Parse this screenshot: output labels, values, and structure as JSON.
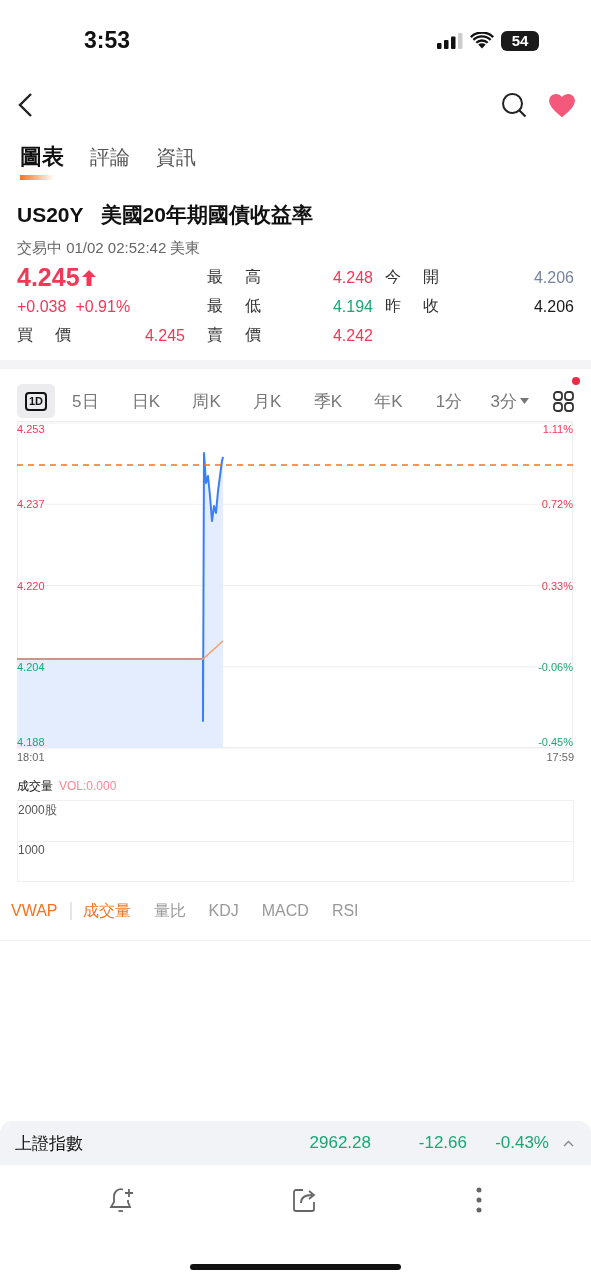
{
  "status_bar": {
    "time": "3:53",
    "battery": "54"
  },
  "nav": {
    "favorite": true
  },
  "tabs": [
    {
      "label": "圖表",
      "selected": true
    },
    {
      "label": "評論",
      "selected": false
    },
    {
      "label": "資訊",
      "selected": false
    }
  ],
  "instrument": {
    "symbol": "US20Y",
    "name": "美國20年期國債收益率",
    "status": "交易中 01/02 02:52:42 美東"
  },
  "quote": {
    "price": "4.245",
    "rising": true,
    "color": "#ee3a57",
    "change": "+0.038",
    "change_pct": "+0.91%",
    "bid": {
      "label": "買 價",
      "value": "4.245",
      "color": "#ee3a57"
    },
    "stats": [
      {
        "label": "最 高",
        "value": "4.248",
        "color": "#ee3a57"
      },
      {
        "label": "今 開",
        "value": "4.206",
        "color": "#7683a0"
      },
      {
        "label": "最 低",
        "value": "4.194",
        "color": "#17a974"
      },
      {
        "label": "昨 收",
        "value": "4.206",
        "color": "#1a1a1a"
      },
      {
        "label": "賣 價",
        "value": "4.242",
        "color": "#ee3a57"
      }
    ]
  },
  "periods": {
    "items": [
      {
        "label": "1D",
        "kind": "icon",
        "selected": true
      },
      {
        "label": "5日",
        "kind": "text",
        "selected": false
      },
      {
        "label": "日K",
        "kind": "text",
        "selected": false
      },
      {
        "label": "周K",
        "kind": "text",
        "selected": false
      },
      {
        "label": "月K",
        "kind": "text",
        "selected": false
      },
      {
        "label": "季K",
        "kind": "text",
        "selected": false
      },
      {
        "label": "年K",
        "kind": "text",
        "selected": false
      },
      {
        "label": "1分",
        "kind": "text",
        "selected": false
      },
      {
        "label": "3分",
        "kind": "dropdown",
        "selected": false
      }
    ],
    "notification": true
  },
  "chart": {
    "y_labels": [
      {
        "label": "4.253",
        "positive": true
      },
      {
        "label": "4.237",
        "positive": true
      },
      {
        "label": "4.220",
        "positive": true
      },
      {
        "label": "4.204",
        "positive": false
      },
      {
        "label": "4.188",
        "positive": false
      }
    ],
    "percent_labels": [
      {
        "label": "1.11%",
        "positive": true
      },
      {
        "label": "0.72%",
        "positive": true
      },
      {
        "label": "0.33%",
        "positive": true
      },
      {
        "label": "-0.06%",
        "positive": false
      },
      {
        "label": "-0.45%",
        "positive": false
      }
    ],
    "x_labels": [
      "18:01",
      "17:59"
    ]
  },
  "volume": {
    "title": "成交量",
    "reading": "VOL:0.000",
    "labels": [
      "2000股",
      "1000"
    ]
  },
  "indicators": {
    "main": [
      {
        "label": "VWAP",
        "selected": true
      }
    ],
    "sub": [
      {
        "label": "成交量",
        "selected": true
      },
      {
        "label": "量比",
        "selected": false
      },
      {
        "label": "KDJ",
        "selected": false
      },
      {
        "label": "MACD",
        "selected": false
      },
      {
        "label": "RSI",
        "selected": false
      }
    ]
  },
  "ticker": {
    "name": "上證指數",
    "value": "2962.28",
    "change": "-12.66",
    "change_pct": "-0.43%",
    "color": "#17a974",
    "expanded": false
  }
}
